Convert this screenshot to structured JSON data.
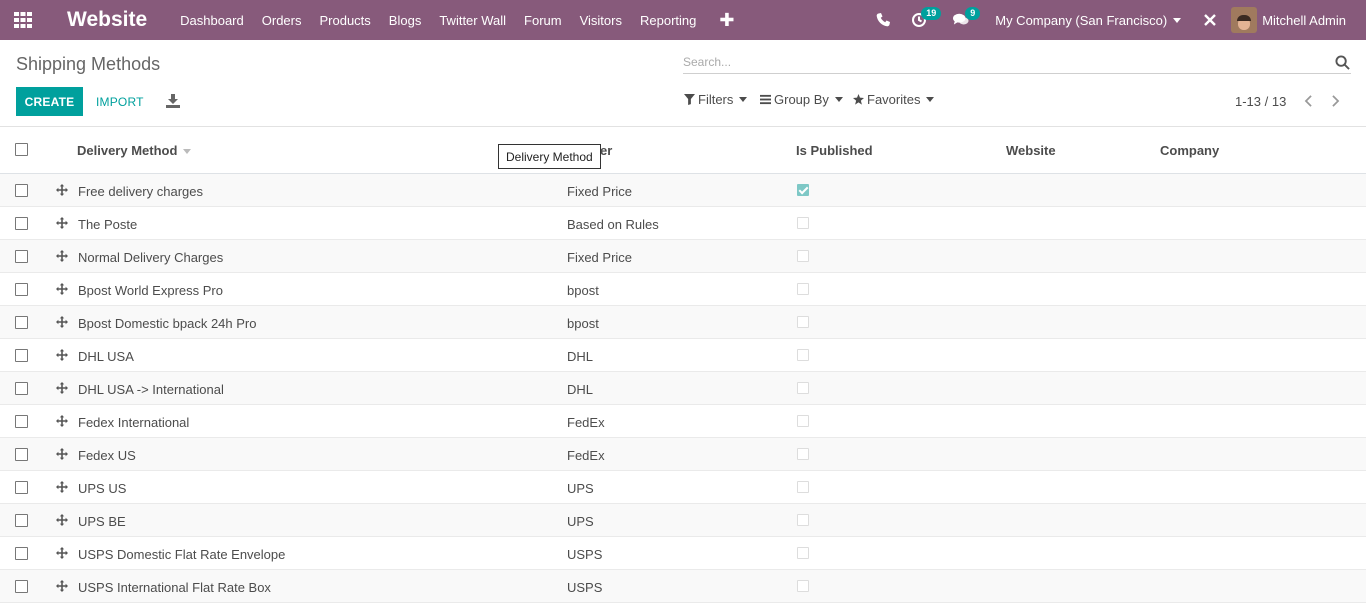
{
  "navbar": {
    "app_title": "Website",
    "menu": [
      "Dashboard",
      "Orders",
      "Products",
      "Blogs",
      "Twitter Wall",
      "Forum",
      "Visitors",
      "Reporting"
    ],
    "activity_count": "19",
    "message_count": "9",
    "company": "My Company (San Francisco)",
    "user_name": "Mitchell Admin",
    "color": "#875a7b"
  },
  "control": {
    "breadcrumb": "Shipping Methods",
    "search_placeholder": "Search...",
    "create_label": "CREATE",
    "import_label": "IMPORT",
    "filters_label": "Filters",
    "groupby_label": "Group By",
    "favorites_label": "Favorites",
    "pager": "1-13 / 13",
    "accent": "#00a09d"
  },
  "table": {
    "columns": [
      "Delivery Method",
      "Provider",
      "Is Published",
      "Website",
      "Company"
    ],
    "header_visible_provider": "er",
    "tooltip": "Delivery Method",
    "rows": [
      {
        "name": "Free delivery charges",
        "provider": "Fixed Price",
        "published": true
      },
      {
        "name": "The Poste",
        "provider": "Based on Rules",
        "published": false
      },
      {
        "name": "Normal Delivery Charges",
        "provider": "Fixed Price",
        "published": false
      },
      {
        "name": "Bpost World Express Pro",
        "provider": "bpost",
        "published": false
      },
      {
        "name": "Bpost Domestic bpack 24h Pro",
        "provider": "bpost",
        "published": false
      },
      {
        "name": "DHL USA",
        "provider": "DHL",
        "published": false
      },
      {
        "name": "DHL USA -> International",
        "provider": "DHL",
        "published": false
      },
      {
        "name": "Fedex International",
        "provider": "FedEx",
        "published": false
      },
      {
        "name": "Fedex US",
        "provider": "FedEx",
        "published": false
      },
      {
        "name": "UPS US",
        "provider": "UPS",
        "published": false
      },
      {
        "name": "UPS BE",
        "provider": "UPS",
        "published": false
      },
      {
        "name": "USPS Domestic Flat Rate Envelope",
        "provider": "USPS",
        "published": false
      },
      {
        "name": "USPS International Flat Rate Box",
        "provider": "USPS",
        "published": false
      }
    ]
  }
}
